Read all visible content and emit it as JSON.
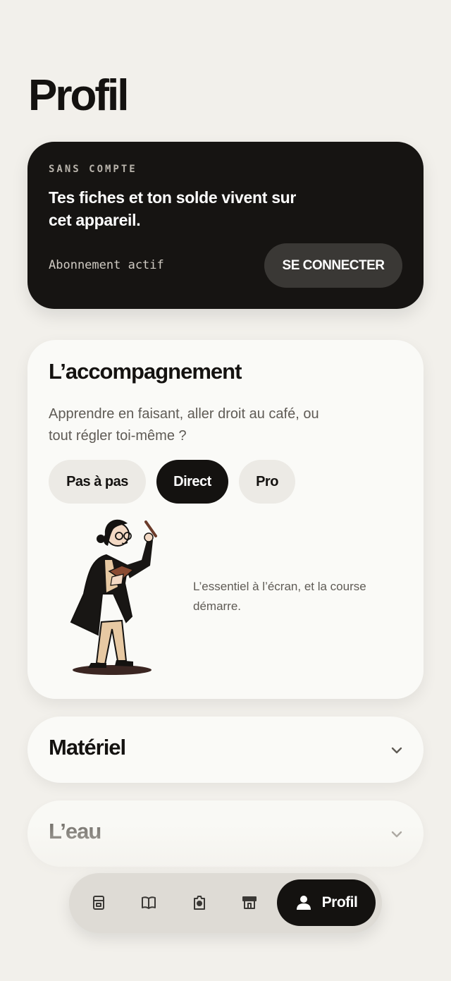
{
  "page": {
    "title": "Profil"
  },
  "account": {
    "eyebrow": "SANS COMPTE",
    "message": "Tes fiches et ton solde vivent sur cet appareil.",
    "status": "Abonnement actif",
    "connect_label": "SE CONNECTER"
  },
  "guidance": {
    "title": "L’accompagnement",
    "description": "Apprendre en faisant, aller droit au café, ou tout régler toi-même ?",
    "modes": [
      {
        "label": "Pas à pas",
        "selected": false
      },
      {
        "label": "Direct",
        "selected": true
      },
      {
        "label": "Pro",
        "selected": false
      }
    ],
    "caption": "L’essentiel à l’écran, et la course démarre."
  },
  "sections": [
    {
      "title": "Matériel",
      "icon": "chevron-down-icon"
    },
    {
      "title": "L’eau",
      "icon": "chevron-down-icon"
    }
  ],
  "nav": {
    "items": [
      {
        "icon": "coffee-machine-icon"
      },
      {
        "icon": "book-icon"
      },
      {
        "icon": "camera-icon"
      },
      {
        "icon": "shop-icon"
      }
    ],
    "active": {
      "icon": "user-icon",
      "label": "Profil"
    }
  },
  "colors": {
    "background": "#f2f0eb",
    "ink": "#141210",
    "card": "#fafaf7",
    "nav_bg": "#dedbd5"
  }
}
